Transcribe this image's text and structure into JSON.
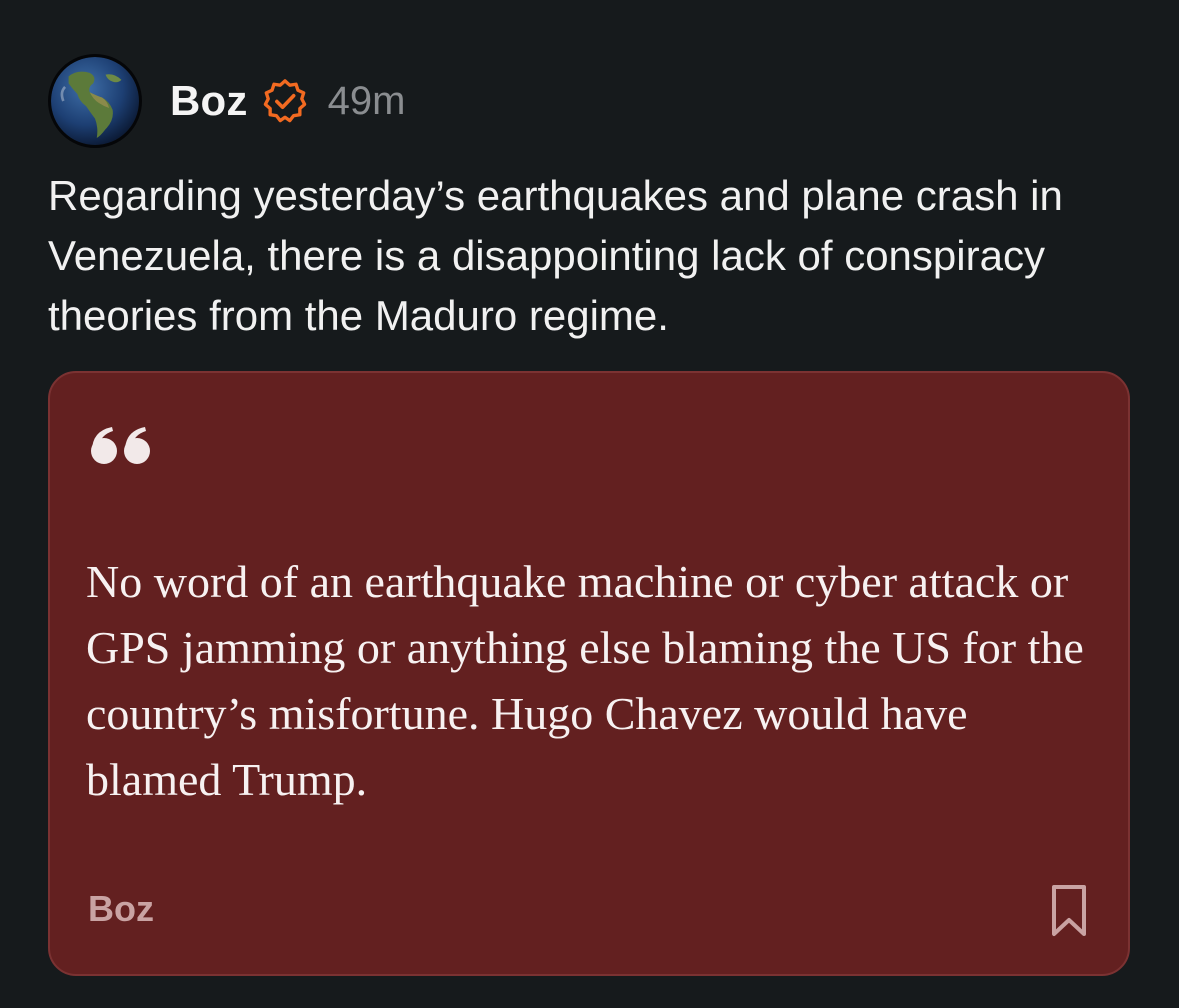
{
  "post": {
    "author": "Boz",
    "verified": true,
    "verified_color": "#f26a21",
    "time": "49m",
    "text": "Regarding yesterday’s earthquakes and plane crash in Venezuela, there is a disappointing lack of conspiracy theories from the Maduro regime."
  },
  "quote_card": {
    "background": "#632020",
    "quote_icon": "quote-open-icon",
    "text": "No word of an earthquake machine or cyber attack or GPS jamming or anything else blaming the US for the country’s misfortune. Hugo Chavez would have blamed Trump.",
    "author": "Boz",
    "bookmark_icon": "bookmark-icon"
  },
  "icons": {
    "avatar": "globe-avatar",
    "verified": "verified-check-icon"
  }
}
